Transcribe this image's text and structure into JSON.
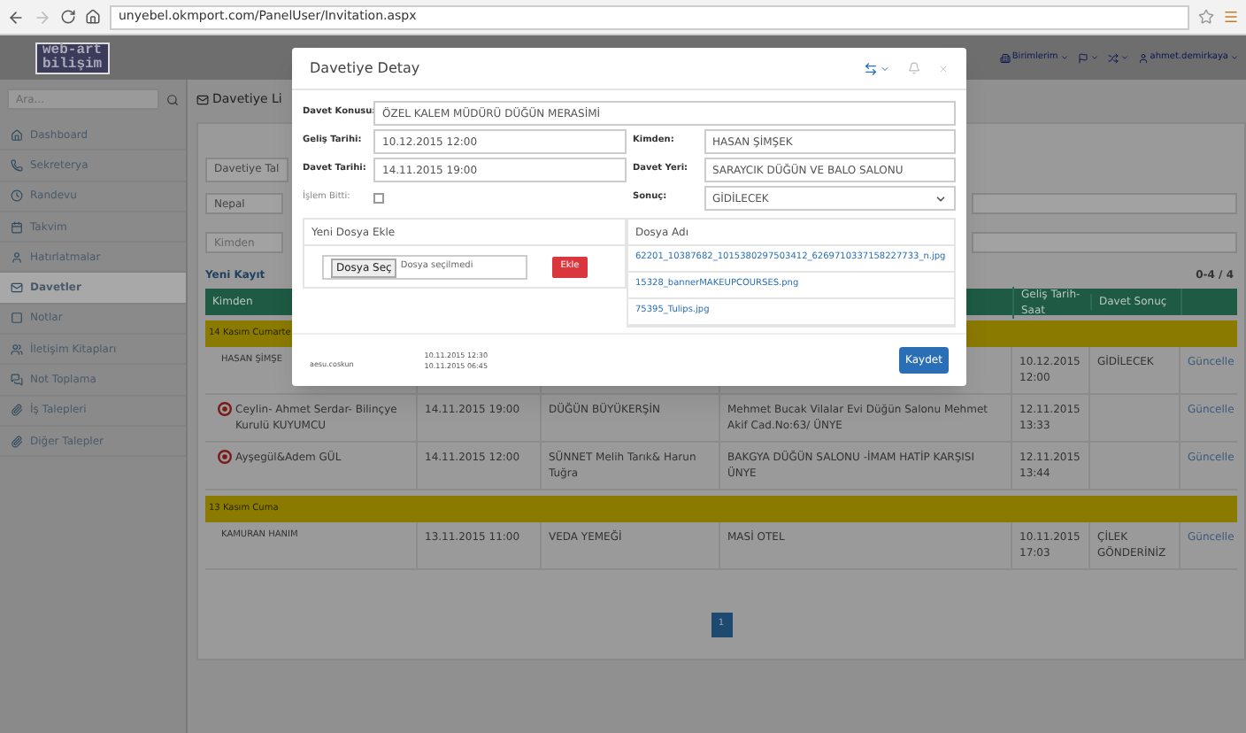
{
  "browser": {
    "url": "unyebel.okmport.com/PanelUser/Invitation.aspx"
  },
  "navbar": {
    "logo_top": "web-art",
    "logo_bottom": "bilişim",
    "items": [
      {
        "kind": "building",
        "label": "Birimlerim"
      },
      {
        "kind": "flag"
      },
      {
        "kind": "shuffle"
      },
      {
        "kind": "user",
        "label": "ahmet.demirkaya"
      }
    ]
  },
  "sidebar": {
    "search_placeholder": "Ara...",
    "items": [
      {
        "kind": "home",
        "label": "Dashboard",
        "selected": false
      },
      {
        "kind": "phone",
        "label": "Sekreterya",
        "selected": false
      },
      {
        "kind": "clock",
        "label": "Randevu",
        "selected": false
      },
      {
        "kind": "calendar",
        "label": "Takvim",
        "selected": false
      },
      {
        "kind": "user",
        "label": "Hatırlatmalar",
        "selected": false
      },
      {
        "kind": "mail",
        "label": "Davetler",
        "selected": true
      },
      {
        "kind": "note",
        "label": "Notlar",
        "selected": false
      },
      {
        "kind": "contacts",
        "label": "İletişim Kitapları",
        "selected": false
      },
      {
        "kind": "chat",
        "label": "Not Toplama",
        "selected": false
      },
      {
        "kind": "clip",
        "label": "İş Talepleri",
        "selected": false
      },
      {
        "kind": "clip",
        "label": "Diğer Talepler",
        "selected": false
      }
    ]
  },
  "page": {
    "title": "Davetiye Li",
    "tab_button": "Davetiye Tal",
    "filter_value": "Nepal",
    "filter_placeholder": "Kimden",
    "new_link": "Yeni Kayıt",
    "count": "0-4 / 4"
  },
  "table": {
    "columns": [
      {
        "label": "Kimden"
      },
      {
        "label": "Geliş Tarih-Saat"
      },
      {
        "label": "Davet Sonuç"
      }
    ],
    "rows": [
      {
        "kind": "group",
        "label": "14 Kasım Cumarte"
      },
      {
        "kind": "row",
        "alert": false,
        "from": "HASAN ŞİMŞE",
        "arrival": "10.12.2015 12:00",
        "result": "GİDİLECEK",
        "action": "Güncelle"
      },
      {
        "kind": "row",
        "alert": true,
        "from": "Ceylin- Ahmet Serdar- Bilinçye Kurulü KUYUMCU",
        "date": "14.11.2015 19:00",
        "topic": "DÜĞÜN BÜYÜKERŞİN",
        "place": "Mehmet Bucak Vilalar Evi Düğün Salonu Mehmet Akif Cad.No:63/ ÜNYE",
        "arrival": "12.11.2015 13:33",
        "action": "Güncelle"
      },
      {
        "kind": "row",
        "alert": true,
        "from": "Ayşegül&Adem GÜL",
        "date": "14.11.2015 12:00",
        "topic": "SÜNNET Melih Tarık& Harun Tuğra",
        "place": "BAKGYA DÜĞÜN SALONU -İMAM HATİP KARŞISI ÜNYE",
        "arrival": "12.11.2015 13:44",
        "action": "Güncelle"
      },
      {
        "kind": "group",
        "label": "13 Kasım Cuma"
      },
      {
        "kind": "row",
        "alert": false,
        "from": "KAMURAN HANIM",
        "date": "13.11.2015 11:00",
        "topic": "VEDA YEMEĞİ",
        "place": "MASİ OTEL",
        "arrival": "10.11.2015 17:03",
        "result": "ÇİLEK GÖNDERİNİZ",
        "action": "Güncelle"
      }
    ]
  },
  "pagination": [
    {
      "label": "1",
      "selected": true
    }
  ],
  "modal": {
    "title": "Davetiye Detay",
    "topic": {
      "label": "Davet Konusu:",
      "value": "ÖZEL KALEM MÜDÜRÜ DÜĞÜN MERASİMİ"
    },
    "fields": [
      {
        "kind": "text",
        "label": "Geliş Tarihi:",
        "value": "10.12.2015 12:00"
      },
      {
        "kind": "text",
        "label": "Kimden:",
        "value": "HASAN ŞİMŞEK"
      },
      {
        "kind": "text",
        "label": "Davet Tarihi:",
        "value": "14.11.2015 19:00"
      },
      {
        "kind": "text",
        "label": "Davet Yeri:",
        "value": "SARAYCIK DÜĞÜN VE BALO SALONU"
      },
      {
        "kind": "checkbox",
        "label": "İşlem Bitti:",
        "checked": false
      },
      {
        "kind": "select",
        "label": "Sonuç:",
        "value": "GİDİLECEK"
      }
    ],
    "upload": {
      "title": "Yeni Dosya Ekle",
      "choose": "Dosya Seç",
      "no_file": "Dosya seçilmedi",
      "add": "Ekle"
    },
    "files": {
      "title": "Dosya Adı",
      "items": [
        "62201_10387682_1015380297503412_6269710337158227733_n.jpg",
        "15328_bannerMAKEUPCOURSES.png",
        "75395_Tulips.jpg"
      ]
    },
    "footer": {
      "user": "aesu.coskun",
      "created": "10.11.2015 12:30",
      "updated": "10.11.2015 06:45",
      "save": "Kaydet"
    }
  }
}
